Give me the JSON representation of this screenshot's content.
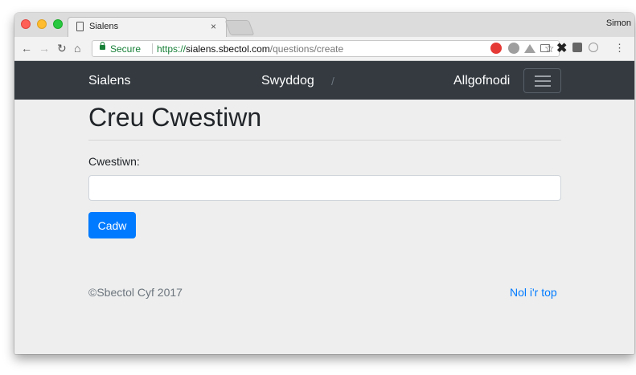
{
  "browser": {
    "tab_title": "Sialens",
    "tab_close": "×",
    "profile_name": "Simon",
    "secure_label": "Secure",
    "url_proto": "https://",
    "url_host": "sialens.sbectol.com",
    "url_path": "/questions/create",
    "extensions": [
      "adblock-plus-icon",
      "w-icon",
      "drive-icon",
      "cast-icon",
      "x-icon",
      "square-icon",
      "circle-icon"
    ]
  },
  "navbar": {
    "brand": "Sialens",
    "center": "Swyddog",
    "slash": "/",
    "logout": "Allgofnodi"
  },
  "main": {
    "title": "Creu Cwestiwn",
    "question_label": "Cwestiwn:",
    "question_value": "",
    "save_button": "Cadw"
  },
  "footer": {
    "copyright": "©Sbectol Cyf 2017",
    "back_to_top": "Nol i'r top"
  },
  "colors": {
    "navbar_bg": "#343a40",
    "primary": "#007bff",
    "page_bg": "#eeeeee",
    "text": "#212529",
    "muted": "#6c757d"
  }
}
